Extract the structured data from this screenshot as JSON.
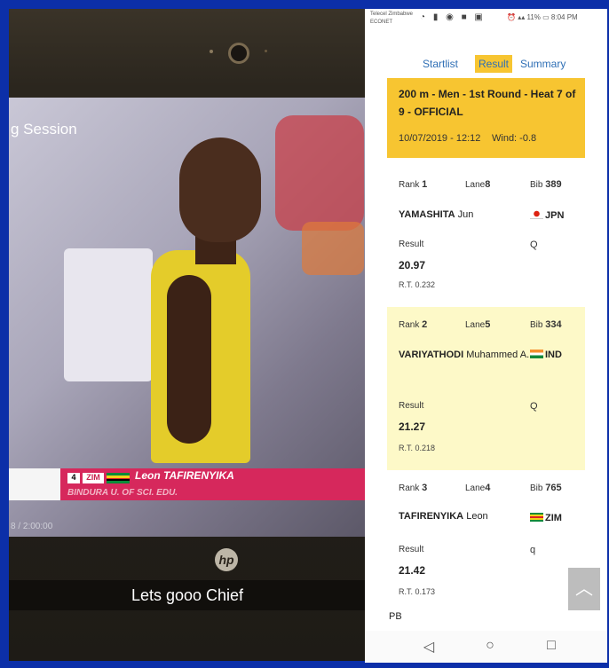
{
  "laptop": {
    "session_text": "g Session",
    "overlay": {
      "bib": "4",
      "country": "ZIM",
      "athlete": "Leon TAFIRENYIKA",
      "school": "BINDURA U. OF SCI. EDU."
    },
    "timecode": "8 / 2:00:00",
    "brand_logo": "hp",
    "caption": "Lets gooo Chief"
  },
  "phone": {
    "status": {
      "carrier": "Telecel Zimbabwe ECONET",
      "battery": "11%",
      "time": "8:04 PM"
    },
    "tabs": [
      {
        "label": "Startlist"
      },
      {
        "label": "Result"
      },
      {
        "label": "Summary"
      }
    ],
    "event": {
      "title": "200 m - Men - 1st Round - Heat 7 of 9 - OFFICIAL",
      "datetime": "10/07/2019 - 12:12",
      "wind": "Wind:  -0.8"
    },
    "labels": {
      "rank": "Rank",
      "lane": "Lane",
      "bib": "Bib",
      "result": "Result",
      "pb": "PB"
    },
    "results": [
      {
        "rank": "1",
        "lane": "8",
        "bib": "389",
        "surname": "YAMASHITA",
        "given": "Jun",
        "nat": "JPN",
        "flag": "jpn",
        "time": "20.97",
        "q": "Q",
        "rt": "R.T. 0.232"
      },
      {
        "rank": "2",
        "lane": "5",
        "bib": "334",
        "surname": "VARIYATHODI",
        "given": "Muhammed A.",
        "nat": "IND",
        "flag": "ind",
        "time": "21.27",
        "q": "Q",
        "rt": "R.T. 0.218"
      },
      {
        "rank": "3",
        "lane": "4",
        "bib": "765",
        "surname": "TAFIRENYIKA",
        "given": "Leon",
        "nat": "ZIM",
        "flag": "zim",
        "time": "21.42",
        "q": "q",
        "rt": "R.T. 0.173"
      }
    ]
  }
}
